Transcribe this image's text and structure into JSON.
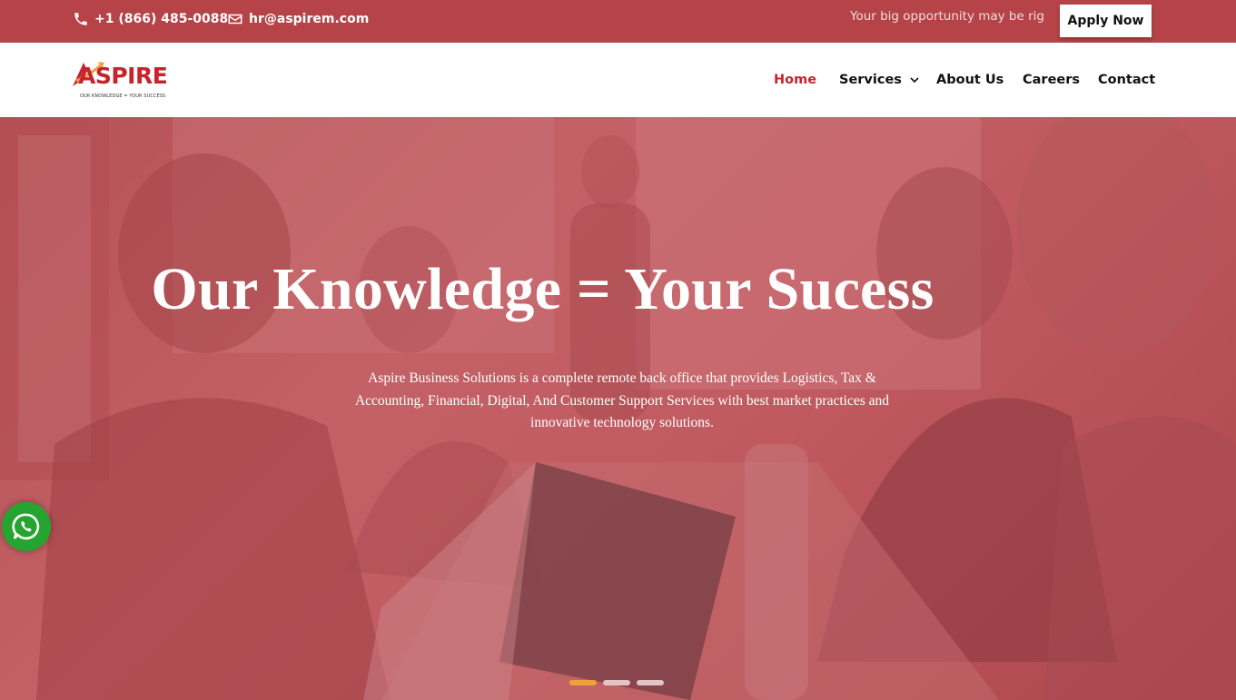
{
  "topbar": {
    "phone": "+1 (866) 485-0088",
    "email": "hr@aspirem.com",
    "marquee": "Your big opportunity may be rig",
    "apply_label": "Apply Now",
    "icons": {
      "phone": "phone-icon",
      "email": "envelope-icon"
    }
  },
  "header": {
    "logo": {
      "word": "ASPIRE",
      "tagline": "OUR KNOWLEDGE = YOUR SUCCESS"
    },
    "nav": [
      {
        "label": "Home",
        "active": true
      },
      {
        "label": "Services",
        "dropdown": true
      },
      {
        "label": "About Us"
      },
      {
        "label": "Careers"
      },
      {
        "label": "Contact"
      }
    ]
  },
  "hero": {
    "title": "Our Knowledge = Your Sucess",
    "description": "Aspire Business Solutions is a complete remote back office that provides Logistics, Tax & Accounting, Financial, Digital, And Customer Support Services with best market practices and innovative technology solutions.",
    "slides_count": 3,
    "active_slide": 1
  },
  "floating": {
    "whatsapp_icon": "whatsapp-icon"
  },
  "colors": {
    "topbar_bg": "#b54347",
    "brand_red": "#c8232c",
    "hero_overlay": "#c0595e",
    "slider_active": "#f0a13a",
    "whatsapp_green": "#25a52f"
  }
}
